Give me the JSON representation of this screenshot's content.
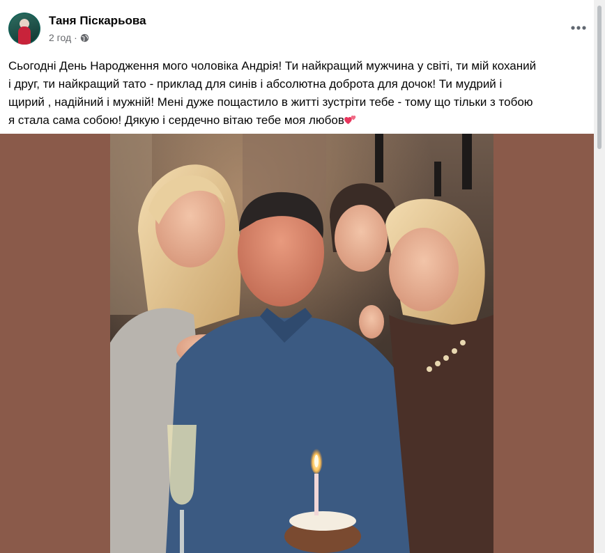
{
  "post": {
    "author": "Таня Піскарьова",
    "time": "2 год",
    "separator": "·",
    "text": "Сьогодні День Народження мого чоловіка Андрія! Ти найкращий мужчина у світі, ти мій коханий і друг, ти найкращий тато - приклад для синів і абсолютна доброта для дочок! Ти мудрий і щирий , надійний і мужній! Мені дуже пощастило в житті зустріти тебе - тому що тільки з тобою я стала сама собою! Дякую і сердечно вітаю тебе моя любов",
    "text_lines": [
      "Сьогодні День Народження мого чоловіка Андрія! Ти найкращий мужчина у світі, ти мій коханий",
      "і друг, ти найкращий тато - приклад для синів і абсолютна доброта для дочок! Ти мудрий і",
      "щирий , надійний і мужній! Мені дуже пощастило в житті зустріти тебе - тому що тільки з тобою",
      "я стала сама собою! Дякую і сердечно вітаю тебе моя любов"
    ],
    "emoji": "two-hearts-icon",
    "audience_icon": "globe-icon",
    "more_icon": "more-options-icon"
  },
  "colors": {
    "photo_background": "#8a5a4a",
    "meta_text": "#65676b",
    "heart": "#e8365d"
  }
}
